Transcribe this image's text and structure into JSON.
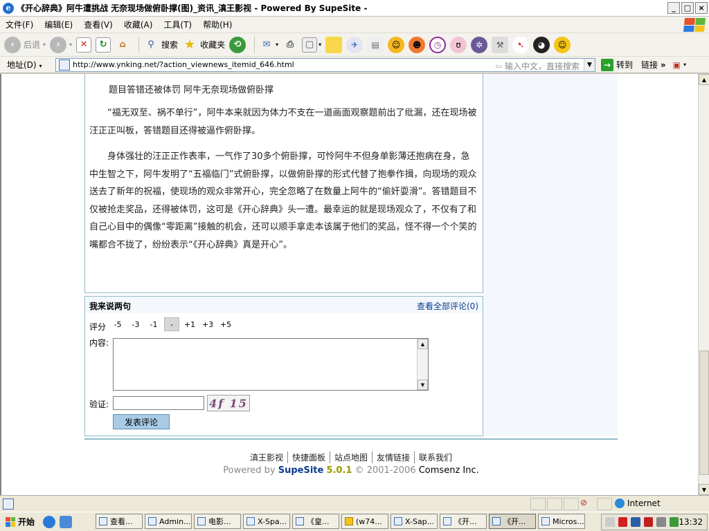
{
  "window": {
    "title": "《开心辞典》阿牛遭挑战 无奈现场做俯卧撑(图)_资讯_滇王影视 - Powered By SupeSite -",
    "min": "_",
    "max": "□",
    "close": "×"
  },
  "menu": [
    "文件(F)",
    "编辑(E)",
    "查看(V)",
    "收藏(A)",
    "工具(T)",
    "帮助(H)"
  ],
  "toolbar": {
    "back": "后退",
    "search": "搜索",
    "favorites": "收藏夹"
  },
  "address": {
    "label": "地址(D)",
    "url": "http://www.ynking.net/?action_viewnews_itemid_646.html",
    "hint": "输入中文，直接搜索",
    "go": "转到",
    "links": "链接"
  },
  "article": {
    "subtitle": "题目答错还被体罚 阿牛无奈现场做俯卧撑",
    "para1": "“福无双至、祸不单行”，阿牛本来就因为体力不支在一道画面观察题前出了纰漏，还在现场被汪正正叫板，答错题目还得被逼作俯卧撑。",
    "para2": "身体强壮的汪正正作表率，一气作了30多个俯卧撑，可怜阿牛不但身单影薄还抱病在身，急中生智之下，阿牛发明了“五福临门”式俯卧撑，以做俯卧撑的形式代替了抱拳作揖，向现场的观众送去了新年的祝福，使现场的观众非常开心，完全忽略了在数量上阿牛的“偷奸耍滑”。答错题目不仅被抢走奖品，还得被体罚，这可是《开心辞典》头一遭。最幸运的就是现场观众了，不仅有了和自己心目中的偶像“零距离”接触的机会，还可以顺手拿走本该属于他们的奖品，怪不得一个个笑的嘴都合不拢了，纷纷表示“《开心辞典》真是开心”。"
  },
  "comment": {
    "title": "我来说两句",
    "view_all": "查看全部评论(0)",
    "score_label": "评分",
    "scores": [
      "-5",
      "-3",
      "-1",
      "-",
      "+1",
      "+3",
      "+5"
    ],
    "content_label": "内容:",
    "verify_label": "验证:",
    "captcha": "4f 15",
    "submit": "发表评论"
  },
  "footer": {
    "links": [
      "滇王影视",
      "快捷面板",
      "站点地图",
      "友情链接",
      "联系我们"
    ],
    "powered_prefix": "Powered by ",
    "brand": "SupeSite",
    "version": "5.0.1",
    "copyright": "© 2001-2006 ",
    "company": "Comsenz Inc."
  },
  "status": {
    "zone": "Internet"
  },
  "taskbar": {
    "start": "开始",
    "tasks": [
      "查看...",
      "Admin...",
      "电影...",
      "X-Spa...",
      "《皇...",
      "(w74...",
      "X-Sap...",
      "《开...",
      "《开...",
      "Micros..."
    ],
    "clock": "13:32"
  }
}
